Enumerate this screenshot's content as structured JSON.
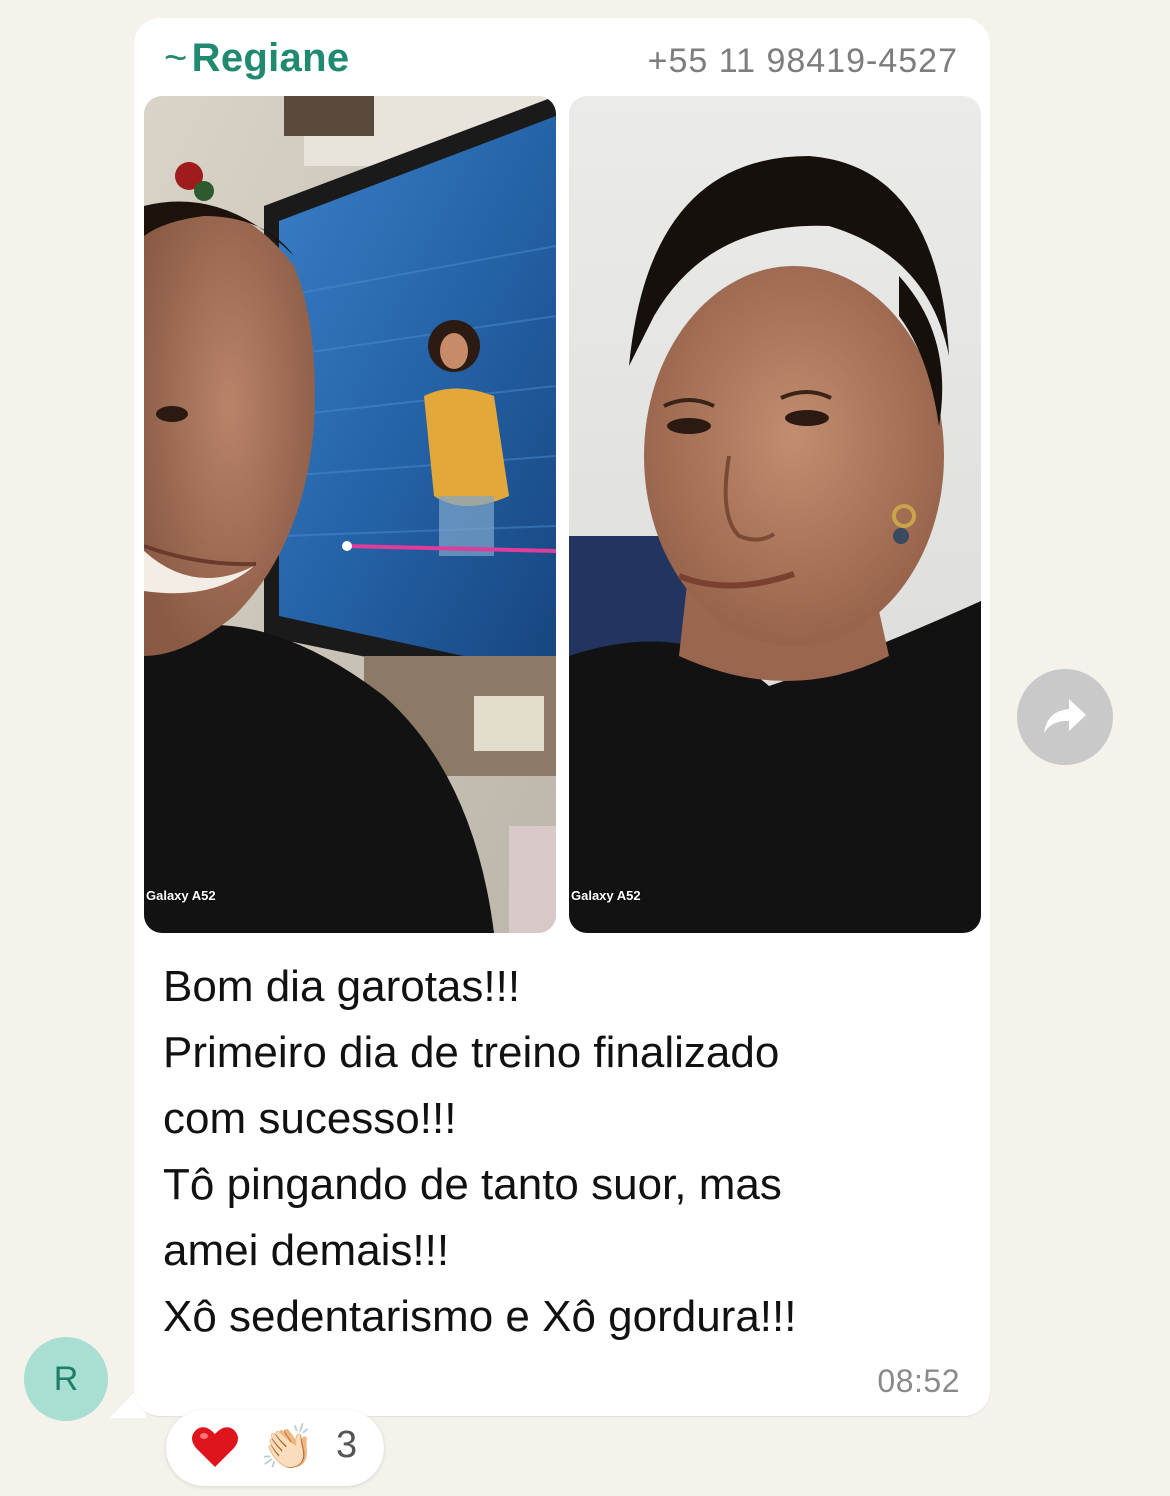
{
  "message": {
    "sender": {
      "prefix": "~",
      "name": "Regiane",
      "phone": "+55 11 98419-4527",
      "avatar_initial": "R"
    },
    "photos": [
      {
        "description": "Selfie in front of a TV showing a workout video",
        "watermark": "Galaxy A52"
      },
      {
        "description": "Close-up selfie after workout",
        "watermark": "Galaxy A52"
      }
    ],
    "text_lines": [
      "Bom dia garotas!!!",
      "Primeiro dia de treino finalizado",
      "com sucesso!!!",
      "Tô pingando de tanto suor, mas",
      "amei demais!!!",
      "Xô sedentarismo e Xô gordura!!!"
    ],
    "time": "08:52"
  },
  "reactions": {
    "emoji_1": "❤️",
    "emoji_2": "👏🏻",
    "count": "3"
  },
  "icons": {
    "forward": "forward-arrow-icon",
    "heart": "heart-icon",
    "clap": "clapping-hands-icon"
  },
  "colors": {
    "background": "#f5f2ec",
    "sender_name": "#1f8a70",
    "avatar_bg": "#a8dfd2",
    "forward_bg": "#c9c9c9"
  }
}
